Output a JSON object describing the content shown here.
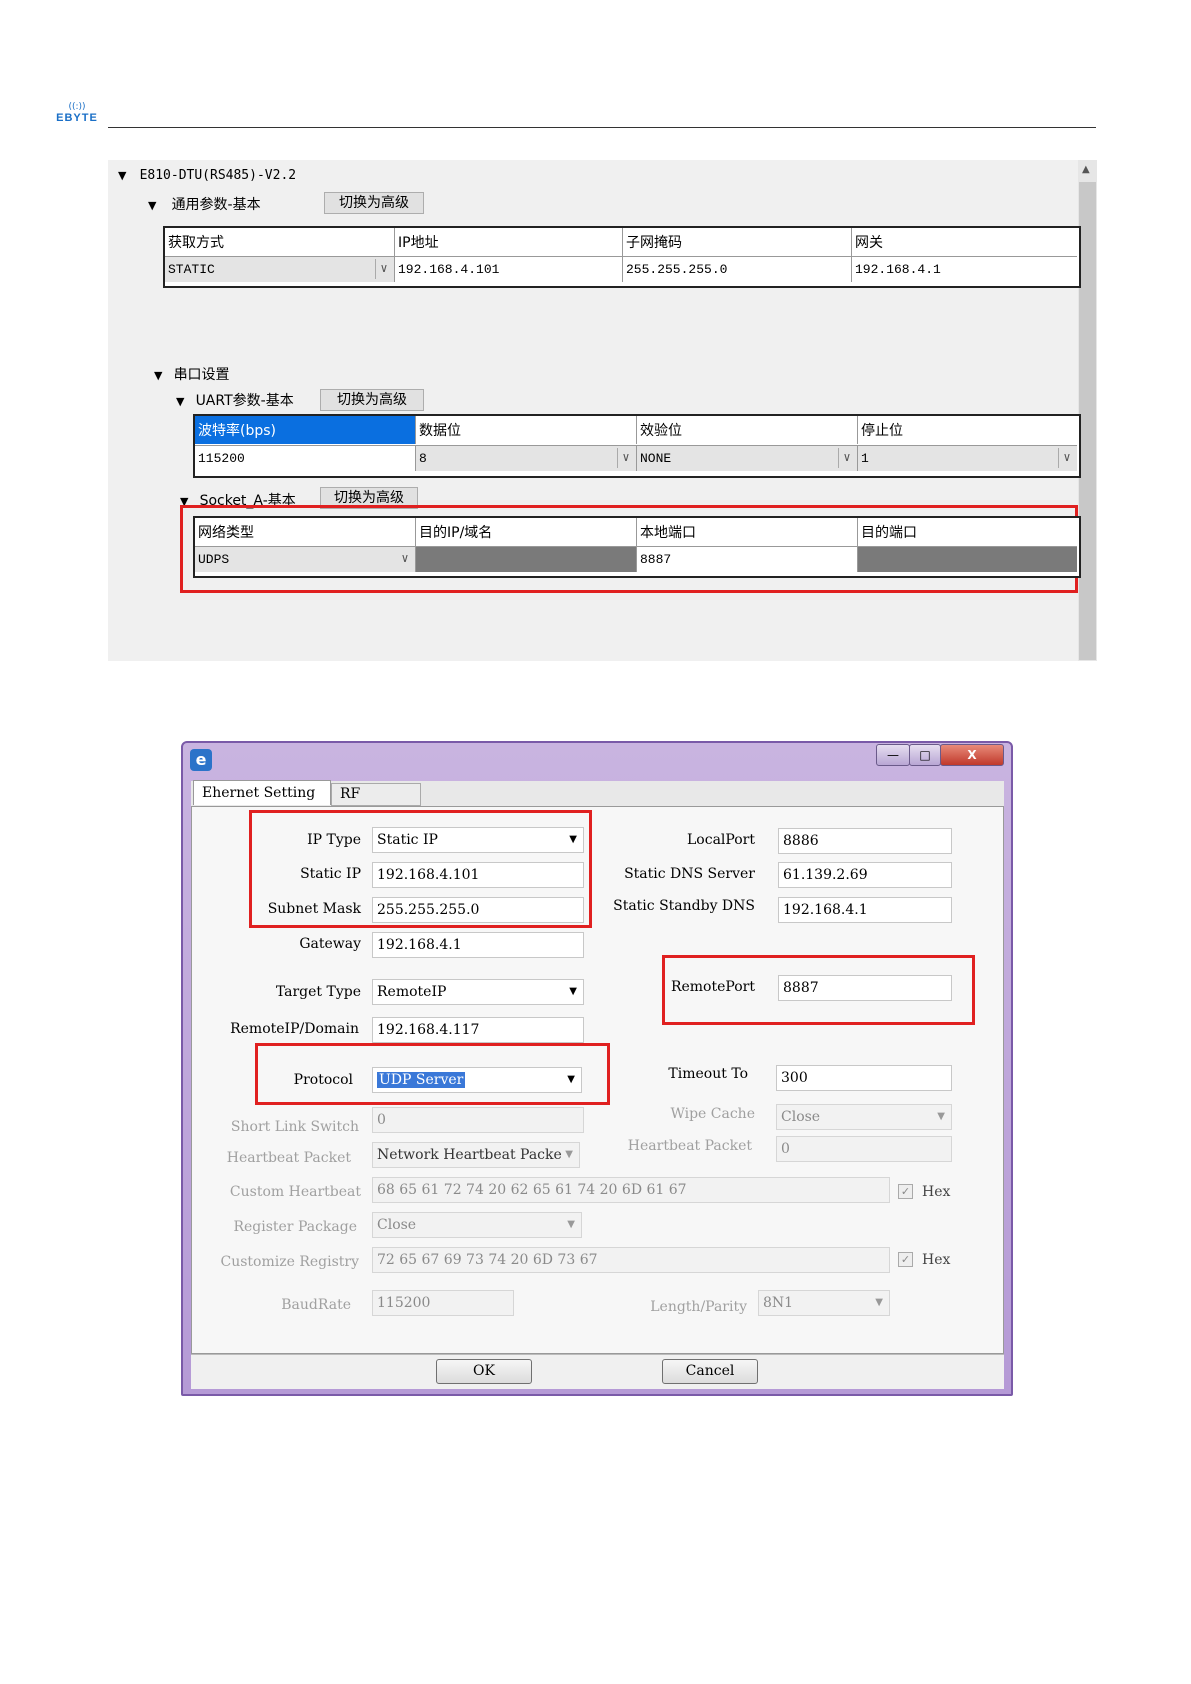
{
  "brand": {
    "waves": "((:))",
    "name": "EBYTE"
  },
  "panel1": {
    "device": "E810-DTU(RS485)-V2.2",
    "general": {
      "title": "通用参数-基本",
      "switch_label": "切换为高级",
      "headers": [
        "获取方式",
        "IP地址",
        "子网掩码",
        "网关"
      ],
      "values": [
        "STATIC",
        "192.168.4.101",
        "255.255.255.0",
        "192.168.4.1"
      ]
    },
    "serial": {
      "title": "串口设置",
      "uart_title": "UART参数-基本",
      "switch_label": "切换为高级",
      "headers": [
        "波特率(bps)",
        "数据位",
        "效验位",
        "停止位"
      ],
      "values": [
        "115200",
        "8",
        "NONE",
        "1"
      ]
    },
    "socket": {
      "title": "Socket_A-基本",
      "switch_label": "切换为高级",
      "headers": [
        "网络类型",
        "目的IP/域名",
        "本地端口",
        "目的端口"
      ],
      "values": [
        "UDPS",
        "",
        "8887",
        ""
      ]
    }
  },
  "window": {
    "icon": "e",
    "controls": {
      "minimize": "—",
      "maximize": "□",
      "close": "X"
    },
    "tabs": [
      "Ehernet Setting",
      "RF Setting"
    ],
    "left_fields": {
      "ip_type": {
        "label": "IP Type",
        "value": "Static IP"
      },
      "static_ip": {
        "label": "Static IP",
        "value": "192.168.4.101"
      },
      "subnet_mask": {
        "label": "Subnet Mask",
        "value": "255.255.255.0"
      },
      "gateway": {
        "label": "Gateway",
        "value": "192.168.4.1"
      },
      "target_type": {
        "label": "Target Type",
        "value": "RemoteIP"
      },
      "remote_domain": {
        "label": "RemoteIP/Domain",
        "value": "192.168.4.117"
      },
      "protocol": {
        "label": "Protocol",
        "value": "UDP Server"
      },
      "short_link": {
        "label": "Short Link Switch",
        "value": "0"
      },
      "heartbeat_packet": {
        "label": "Heartbeat Packet",
        "value": "Network Heartbeat Packe"
      },
      "custom_heartbeat": {
        "label": "Custom Heartbeat",
        "value": "68 65 61 72 74 20 62 65 61 74 20 6D 61 67"
      },
      "register_package": {
        "label": "Register Package",
        "value": "Close"
      },
      "customize_registry": {
        "label": "Customize Registry",
        "value": "72 65 67 69 73 74 20 6D 73 67"
      },
      "baudrate": {
        "label": "BaudRate",
        "value": "115200"
      }
    },
    "right_fields": {
      "local_port": {
        "label": "LocalPort",
        "value": "8886"
      },
      "static_dns": {
        "label": "Static DNS Server",
        "value": "61.139.2.69"
      },
      "standby_dns": {
        "label": "Static Standby DNS",
        "value": "192.168.4.1"
      },
      "remote_port": {
        "label": "RemotePort",
        "value": "8887"
      },
      "timeout": {
        "label": "Timeout To",
        "value": "300"
      },
      "wipe_cache": {
        "label": "Wipe Cache",
        "value": "Close"
      },
      "heartbeat_packet2": {
        "label": "Heartbeat Packet",
        "value": "0"
      },
      "length_parity": {
        "label": "Length/Parity",
        "value": "8N1"
      }
    },
    "hex_label": "Hex",
    "check_mark": "✓",
    "ok_label": "OK",
    "cancel_label": "Cancel"
  }
}
